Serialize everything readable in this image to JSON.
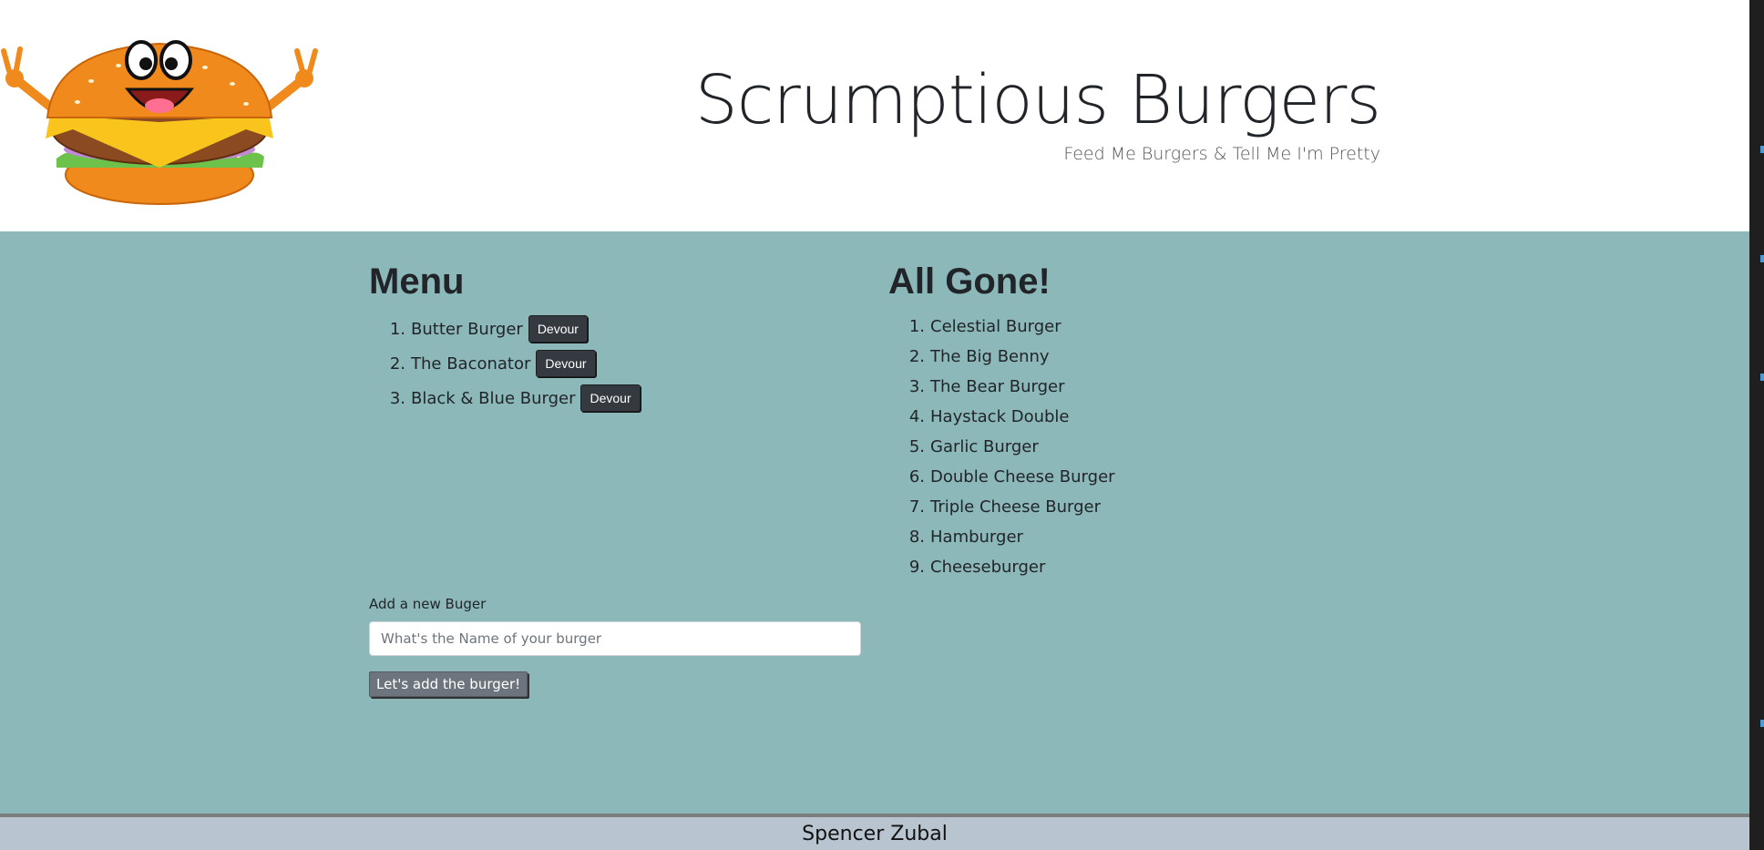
{
  "header": {
    "title": "Scrumptious Burgers",
    "subtitle": "Feed Me Burgers & Tell Me I'm Pretty",
    "logo_icon": "burger-mascot-icon"
  },
  "menu": {
    "heading": "Menu",
    "devour_label": "Devour",
    "items": [
      {
        "num": "1.",
        "name": "Butter Burger"
      },
      {
        "num": "2.",
        "name": "The Baconator"
      },
      {
        "num": "3.",
        "name": "Black & Blue Burger"
      }
    ]
  },
  "gone": {
    "heading": "All Gone!",
    "items": [
      {
        "num": "1.",
        "name": "Celestial Burger"
      },
      {
        "num": "2.",
        "name": "The Big Benny"
      },
      {
        "num": "3.",
        "name": "The Bear Burger"
      },
      {
        "num": "4.",
        "name": "Haystack Double"
      },
      {
        "num": "5.",
        "name": "Garlic Burger"
      },
      {
        "num": "6.",
        "name": "Double Cheese Burger"
      },
      {
        "num": "7.",
        "name": "Triple Cheese Burger"
      },
      {
        "num": "8.",
        "name": "Hamburger"
      },
      {
        "num": "9.",
        "name": "Cheeseburger"
      }
    ]
  },
  "form": {
    "label": "Add a new Buger",
    "placeholder": "What's the Name of your burger",
    "value": "",
    "submit_label": "Let's add the burger!"
  },
  "footer": {
    "text": "Spencer Zubal"
  },
  "colors": {
    "main_bg": "#8cb8b9",
    "footer_bg": "#b8c5d0",
    "devour_button": "#343a40",
    "add_button": "#6c757d"
  }
}
